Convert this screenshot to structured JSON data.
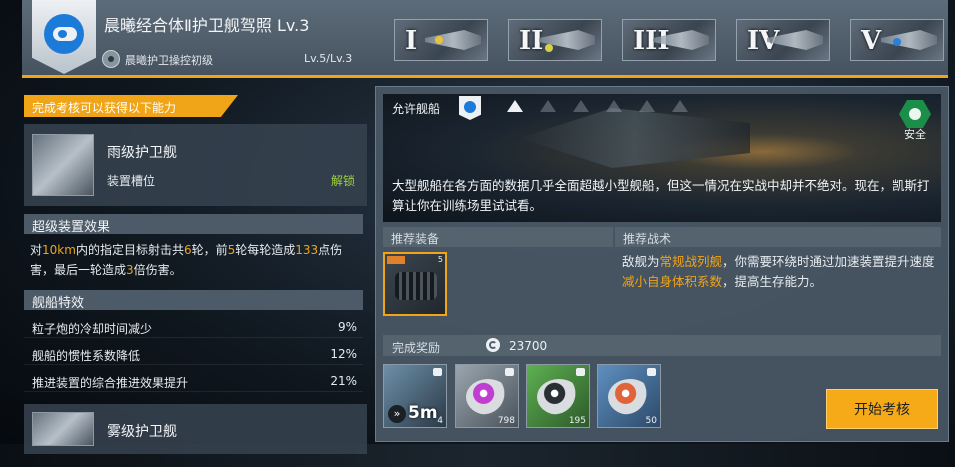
{
  "header": {
    "license_title": "晨曦经合体Ⅱ护卫舰驾照 Lv.3",
    "control_label": "晨曦护卫操控初级",
    "control_level": "Lv.5/Lv.3",
    "tiers": [
      "I",
      "II",
      "III",
      "IV",
      "V"
    ]
  },
  "left": {
    "unlock_banner": "完成考核可以获得以下能力",
    "ship1": {
      "name": "雨级护卫舰",
      "slot_label": "装置槽位",
      "unlock_label": "解锁"
    },
    "super_effect": {
      "title": "超级装置效果",
      "parts": [
        "对",
        "10km",
        "内的指定目标射击共",
        "6",
        "轮，前",
        "5",
        "轮每轮造成",
        "133",
        "点伤害，最后一轮造成",
        "3",
        "倍伤害。"
      ]
    },
    "traits_title": "舰船特效",
    "traits": [
      {
        "label": "粒子炮的冷却时间减少",
        "value": "9%"
      },
      {
        "label": "舰船的惯性系数降低",
        "value": "12%"
      },
      {
        "label": "推进装置的综合推进效果提升",
        "value": "21%"
      }
    ],
    "ship2": {
      "name": "雾级护卫舰"
    }
  },
  "right": {
    "allowed_label": "允许舰船",
    "safety_label": "安全",
    "scene_text": "大型舰船在各方面的数据几乎全面超越小型舰船，但这一情况在实战中却并不绝对。现在，凯斯打算让你在训练场里试试看。",
    "rec_equip_label": "推荐装备",
    "rec_tactic_label": "推荐战术",
    "equip_level": "5",
    "tactic_parts": [
      "敌舰为",
      "常规战列舰",
      "，你需要环绕时通过加速装置提升速度",
      "减小自身体积系数",
      "，提高生存能力。"
    ],
    "reward_label": "完成奖励",
    "credits": "23700",
    "rewards": [
      {
        "icon": "speed-boost-icon",
        "badge": "5m",
        "count": "4"
      },
      {
        "icon": "purple-ore-icon",
        "count": "798"
      },
      {
        "icon": "silver-ore-icon",
        "count": "195"
      },
      {
        "icon": "orange-ore-icon",
        "count": "50"
      }
    ],
    "start_button": "开始考核"
  },
  "colors": {
    "accent": "#f0a418",
    "unlock_green": "#9fd13a",
    "safety_green": "#1b8f4a"
  }
}
